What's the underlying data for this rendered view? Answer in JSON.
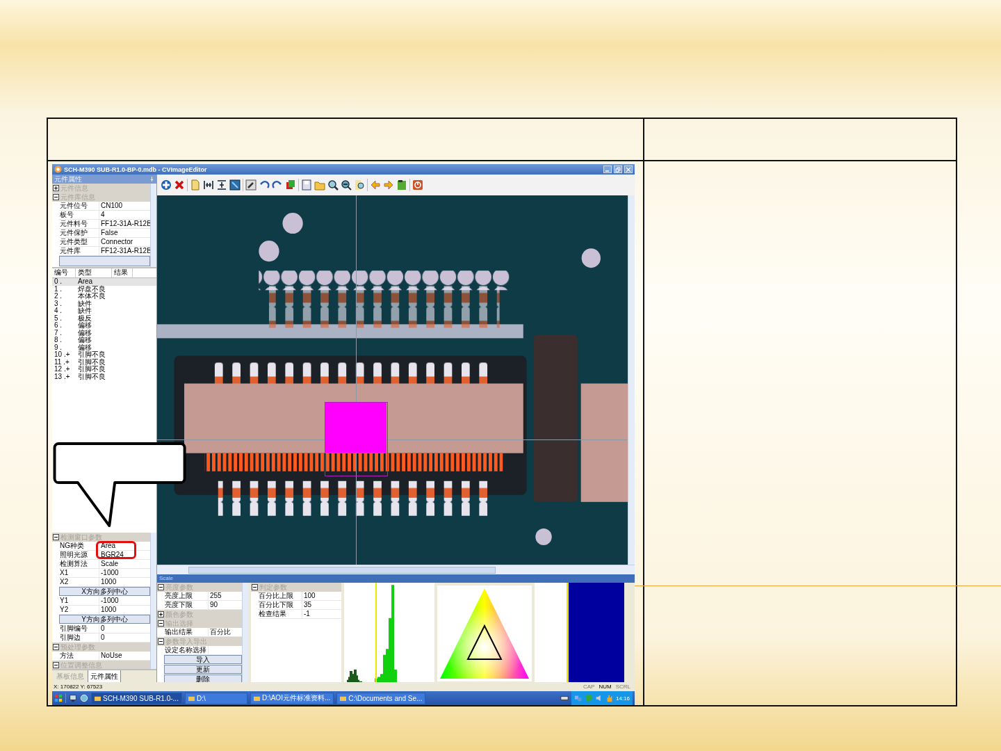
{
  "window": {
    "title": "SCH-M390 SUB-R1.0-BP-0.mdb - CVImageEditor"
  },
  "property_panel": {
    "title": "元件属性",
    "groups": [
      {
        "title": "元件信息",
        "expanded": false
      },
      {
        "title": "元件库信息",
        "expanded": true,
        "rows": [
          {
            "label": "元件位号",
            "value": "CN100"
          },
          {
            "label": "板号",
            "value": "4"
          },
          {
            "label": "元件料号",
            "value": "FF12-31A-R12B"
          },
          {
            "label": "元件保护",
            "value": "False"
          },
          {
            "label": "元件类型",
            "value": "Connector"
          },
          {
            "label": "元件库",
            "value": "FF12-31A-R12B"
          }
        ]
      }
    ]
  },
  "defect_list": {
    "columns": [
      "编号",
      "类型",
      "结果"
    ],
    "rows": [
      {
        "no": "0 .",
        "type": "Area",
        "selected": true
      },
      {
        "no": "1 .",
        "type": "焊盘不良",
        "selected": false
      },
      {
        "no": "2 .",
        "type": "本体不良",
        "selected": false
      },
      {
        "no": "3 .",
        "type": "缺件",
        "selected": false
      },
      {
        "no": "4 .",
        "type": "缺件",
        "selected": false
      },
      {
        "no": "5 .",
        "type": "极反",
        "selected": false
      },
      {
        "no": "6 .",
        "type": "偏移",
        "selected": false
      },
      {
        "no": "7 .",
        "type": "偏移",
        "selected": false
      },
      {
        "no": "8 .",
        "type": "偏移",
        "selected": false
      },
      {
        "no": "9 .",
        "type": "偏移",
        "selected": false
      },
      {
        "no": "10 .+",
        "type": "引脚不良",
        "selected": false
      },
      {
        "no": "11 .+",
        "type": "引脚不良",
        "selected": false
      },
      {
        "no": "12 .+",
        "type": "引脚不良",
        "selected": false
      },
      {
        "no": "13 .+",
        "type": "引脚不良",
        "selected": false
      }
    ]
  },
  "detect_props": [
    {
      "kind": "group",
      "title": "检测窗口参数",
      "expanded": true
    },
    {
      "kind": "row",
      "label": "NG种类",
      "value": "Area"
    },
    {
      "kind": "row",
      "label": "照明光源",
      "value": "BGR24"
    },
    {
      "kind": "row",
      "label": "检测算法",
      "value": "Scale"
    },
    {
      "kind": "row",
      "label": "X1",
      "value": "-1000"
    },
    {
      "kind": "row",
      "label": "X2",
      "value": "1000"
    },
    {
      "kind": "button",
      "label": "X方向多列中心"
    },
    {
      "kind": "row",
      "label": "Y1",
      "value": "-1000"
    },
    {
      "kind": "row",
      "label": "Y2",
      "value": "1000"
    },
    {
      "kind": "button",
      "label": "Y方向多列中心"
    },
    {
      "kind": "row",
      "label": "引脚编号",
      "value": "0"
    },
    {
      "kind": "row",
      "label": "引脚边",
      "value": "0"
    },
    {
      "kind": "group",
      "title": "预处理参数",
      "expanded": true
    },
    {
      "kind": "row",
      "label": "方法",
      "value": "NoUse"
    },
    {
      "kind": "group",
      "title": "位置调整信息",
      "expanded": true
    }
  ],
  "left_tabs": [
    {
      "label": "基板信息",
      "selected": false
    },
    {
      "label": "元件属性",
      "selected": true
    }
  ],
  "scale_panel": {
    "title": "Scale",
    "left_items": [
      {
        "kind": "group",
        "title": "亮度参数",
        "expanded": true
      },
      {
        "kind": "row",
        "label": "亮度上限",
        "value": "255"
      },
      {
        "kind": "row",
        "label": "亮度下限",
        "value": "90"
      },
      {
        "kind": "group",
        "title": "颜色参数",
        "expanded": false
      },
      {
        "kind": "group",
        "title": "输出选择",
        "expanded": true
      },
      {
        "kind": "row",
        "label": "输出结果",
        "value": "百分比"
      },
      {
        "kind": "group",
        "title": "参数导入导出",
        "expanded": true
      },
      {
        "kind": "row",
        "label": "设定名称选择"
      },
      {
        "kind": "button",
        "label": "导入"
      },
      {
        "kind": "button",
        "label": "更新"
      },
      {
        "kind": "button",
        "label": "删除"
      }
    ],
    "right_items": [
      {
        "kind": "group",
        "title": "判定参数",
        "expanded": true
      },
      {
        "kind": "row",
        "label": "百分比上限",
        "value": "100"
      },
      {
        "kind": "row",
        "label": "百分比下限",
        "value": "35"
      },
      {
        "kind": "row",
        "label": "检查结果",
        "value": "-1"
      }
    ]
  },
  "status_bar": {
    "coords": "X: 170822 Y: 67523",
    "indicators": [
      {
        "label": "CAP",
        "on": false
      },
      {
        "label": "NUM",
        "on": true
      },
      {
        "label": "SCRL",
        "on": false
      }
    ]
  },
  "taskbar": {
    "tasks": [
      {
        "label": "SCH-M390 SUB-R1.0-...",
        "selected": true
      },
      {
        "label": "D:\\",
        "selected": false
      },
      {
        "label": "D:\\AOI元件标准资料...",
        "selected": false
      },
      {
        "label": "C:\\Documents and Se...",
        "selected": false
      }
    ],
    "clock": "14:16"
  }
}
